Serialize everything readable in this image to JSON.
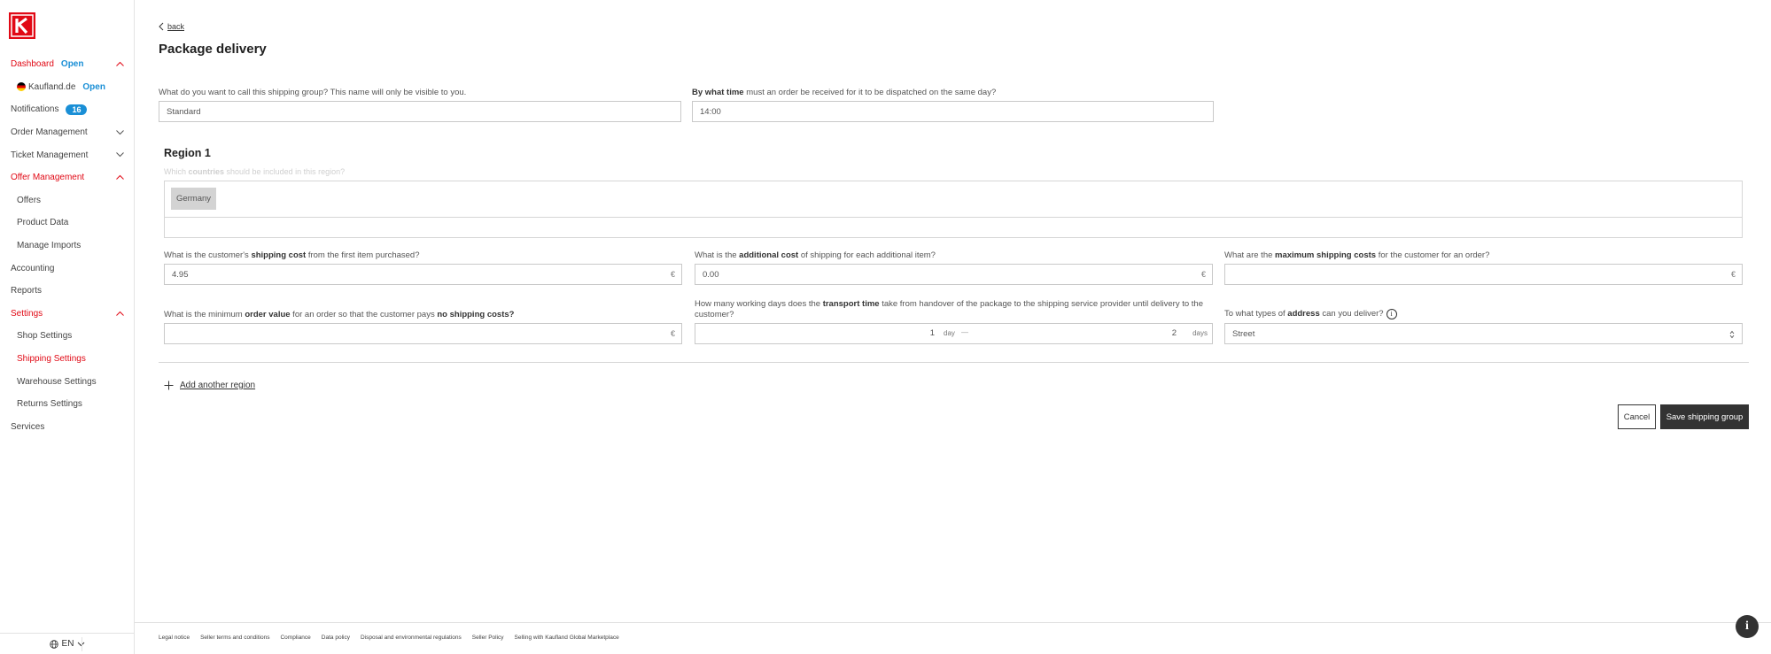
{
  "sidebar": {
    "items": [
      {
        "label": "Dashboard",
        "tag": "Open",
        "active": true,
        "chevron": "up"
      },
      {
        "label": "Kaufland.de",
        "tag": "Open",
        "sub": true,
        "flag": "de"
      },
      {
        "label": "Notifications",
        "badge": "16"
      },
      {
        "label": "Order Management",
        "chevron": "down"
      },
      {
        "label": "Ticket Management",
        "chevron": "down"
      },
      {
        "label": "Offer Management",
        "active": true,
        "chevron": "up"
      },
      {
        "label": "Offers",
        "sub": true
      },
      {
        "label": "Product Data",
        "sub": true
      },
      {
        "label": "Manage Imports",
        "sub": true
      },
      {
        "label": "Accounting"
      },
      {
        "label": "Reports"
      },
      {
        "label": "Settings",
        "active": true,
        "chevron": "up"
      },
      {
        "label": "Shop Settings",
        "sub": true
      },
      {
        "label": "Shipping Settings",
        "sub": true,
        "active": true
      },
      {
        "label": "Warehouse Settings",
        "sub": true
      },
      {
        "label": "Returns Settings",
        "sub": true
      },
      {
        "label": "Services"
      }
    ],
    "language": "EN"
  },
  "header": {
    "back_label": "back",
    "title": "Package delivery"
  },
  "form": {
    "group_name": {
      "label": "What do you want to call this shipping group? This name will only be visible to you.",
      "value": "Standard"
    },
    "cutoff": {
      "label_bold": "By what time",
      "label_rest": " must an order be received for it to be dispatched on the same day?",
      "value": "14:00"
    }
  },
  "region": {
    "title": "Region 1",
    "countries_label_pre": "Which ",
    "countries_label_bold": "countries",
    "countries_label_post": " should be included in this region?",
    "countries": [
      "Germany"
    ],
    "shipping_cost": {
      "label_pre": "What is the customer's ",
      "label_bold": "shipping cost",
      "label_post": " from the first item purchased?",
      "value": "4.95",
      "unit": "€"
    },
    "additional_cost": {
      "label_pre": "What is the ",
      "label_bold": "additional cost",
      "label_post": " of shipping for each additional item?",
      "value": "0.00",
      "unit": "€"
    },
    "max_cost": {
      "label_pre": "What are the ",
      "label_bold": "maximum shipping costs",
      "label_post": " for the customer for an order?",
      "value": "",
      "unit": "€"
    },
    "min_order": {
      "label_pre": "What is the minimum ",
      "label_bold": "order value",
      "label_mid": " for an order so that the customer pays ",
      "label_bold2": "no shipping costs?",
      "value": "",
      "unit": "€"
    },
    "transport": {
      "label_pre": "How many working days does the ",
      "label_bold": "transport time",
      "label_post": " take from handover of the package to the shipping service provider until delivery to the customer?",
      "from": "1",
      "from_unit": "day",
      "separator": "—",
      "to": "2",
      "to_unit": "days"
    },
    "address": {
      "label_pre": "To what types of ",
      "label_bold": "address",
      "label_post": " can you deliver?",
      "value": "Street"
    }
  },
  "actions": {
    "add_region": "Add another region",
    "cancel": "Cancel",
    "save": "Save shipping group"
  },
  "footer": {
    "links": [
      "Legal notice",
      "Seller terms and conditions",
      "Compliance",
      "Data policy",
      "Disposal and environmental regulations",
      "Seller Policy",
      "Selling with Kaufland Global Marketplace"
    ]
  },
  "colors": {
    "brand_red": "#e10915",
    "accent_blue": "#1a8fd6",
    "dark_button": "#333333"
  }
}
